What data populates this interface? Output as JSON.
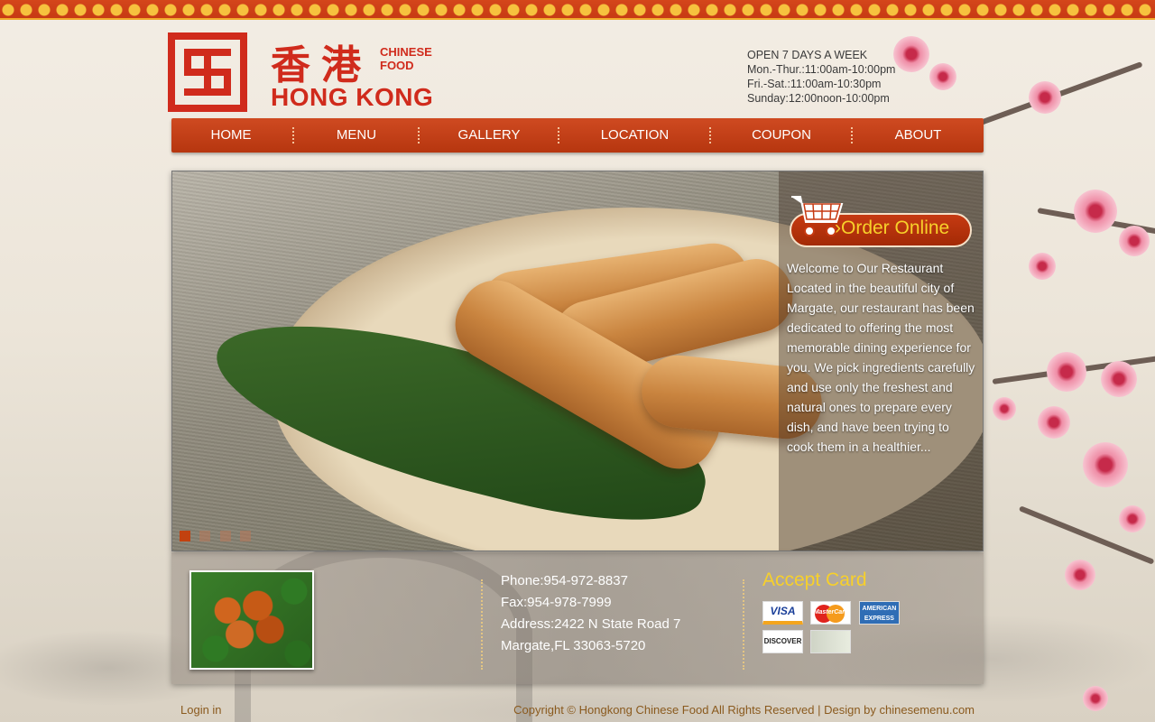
{
  "brand": {
    "name_cn": "香港",
    "tagline_line1": "CHINESE",
    "tagline_line2": "FOOD",
    "name_en": "HONG KONG"
  },
  "hours": {
    "heading": "OPEN 7 DAYS A WEEK",
    "lines": [
      "Mon.-Thur.:11:00am-10:00pm",
      "Fri.-Sat.:11:00am-10:30pm",
      "Sunday:12:00noon-10:00pm"
    ]
  },
  "nav": {
    "items": [
      {
        "label": "HOME"
      },
      {
        "label": "MENU"
      },
      {
        "label": "GALLERY"
      },
      {
        "label": "LOCATION"
      },
      {
        "label": "COUPON"
      },
      {
        "label": "ABOUT"
      }
    ]
  },
  "hero": {
    "order_label": "Order Online",
    "welcome_text": "Welcome to Our Restaurant Located in the beautiful city of Margate, our restaurant has been dedicated to offering the most memorable dining experience for you. We pick ingredients carefully and use only the freshest and natural ones to prepare every dish, and have been trying to cook them in a healthier...",
    "slide_count": 4,
    "active_slide": 1
  },
  "contact": {
    "phone": "Phone:954-972-8837",
    "fax": "Fax:954-978-7999",
    "address_line1": "Address:2422 N State Road 7",
    "address_line2": "Margate,FL 33063-5720"
  },
  "payment": {
    "title": "Accept Card",
    "cards": [
      {
        "name": "visa-card-icon",
        "label": "VISA"
      },
      {
        "name": "mastercard-icon",
        "label": "MasterCard"
      },
      {
        "name": "amex-card-icon",
        "label": "AMERICAN EXPRESS"
      },
      {
        "name": "discover-card-icon",
        "label": "DISCOVER"
      },
      {
        "name": "cash-icon",
        "label": ""
      }
    ]
  },
  "footer": {
    "login_label": "Login in",
    "copyright": "Copyright © Hongkong Chinese Food  All Rights Reserved | Design by chinesemenu.com"
  },
  "colors": {
    "brand_red": "#d02b1c",
    "nav_orange": "#c2410f",
    "accent_yellow": "#f7d02a"
  }
}
